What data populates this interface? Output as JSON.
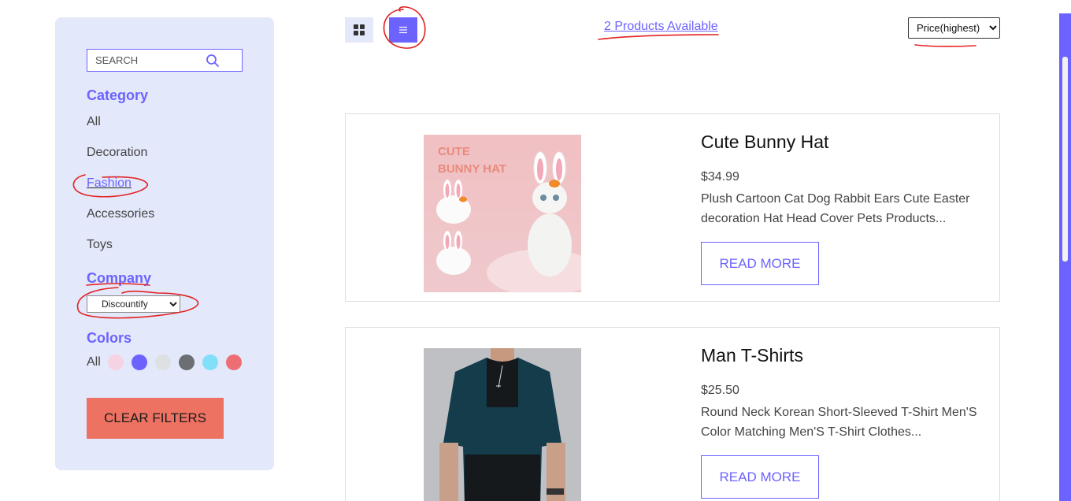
{
  "search": {
    "placeholder": "SEARCH"
  },
  "filters": {
    "category_title": "Category",
    "categories": [
      {
        "label": "All",
        "active": false
      },
      {
        "label": "Decoration",
        "active": false
      },
      {
        "label": "Fashion",
        "active": true
      },
      {
        "label": "Accessories",
        "active": false
      },
      {
        "label": "Toys",
        "active": false
      }
    ],
    "company_title": "Company",
    "company_selected": "Discountify",
    "colors_title": "Colors",
    "colors_all": "All",
    "colors": [
      "#f5d3e3",
      "#6c63ff",
      "#dde1e4",
      "#6b6f73",
      "#82dffa",
      "#ee6f73"
    ],
    "clear_label": "CLEAR FILTERS"
  },
  "toolbar": {
    "grid_icon": "grid-icon",
    "list_icon": "list-icon",
    "products_count": "2 Products Available",
    "sort_selected": "Price(highest)"
  },
  "products": [
    {
      "name": "Cute Bunny Hat",
      "price": "$34.99",
      "description": "Plush Cartoon Cat Dog Rabbit Ears Cute Easter decoration Hat Head Cover Pets Products...",
      "button": "READ MORE",
      "image_text": "CUTE BUNNY HAT"
    },
    {
      "name": "Man T-Shirts",
      "price": "$25.50",
      "description": "Round Neck Korean Short-Sleeved T-Shirt Men'S Color Matching Men'S T-Shirt Clothes...",
      "button": "READ MORE"
    }
  ],
  "colors": {
    "accent": "#6c63ff",
    "sidebar_bg": "#e3e8fb",
    "clear_button": "#ee7262",
    "annotation": "#e32222"
  }
}
